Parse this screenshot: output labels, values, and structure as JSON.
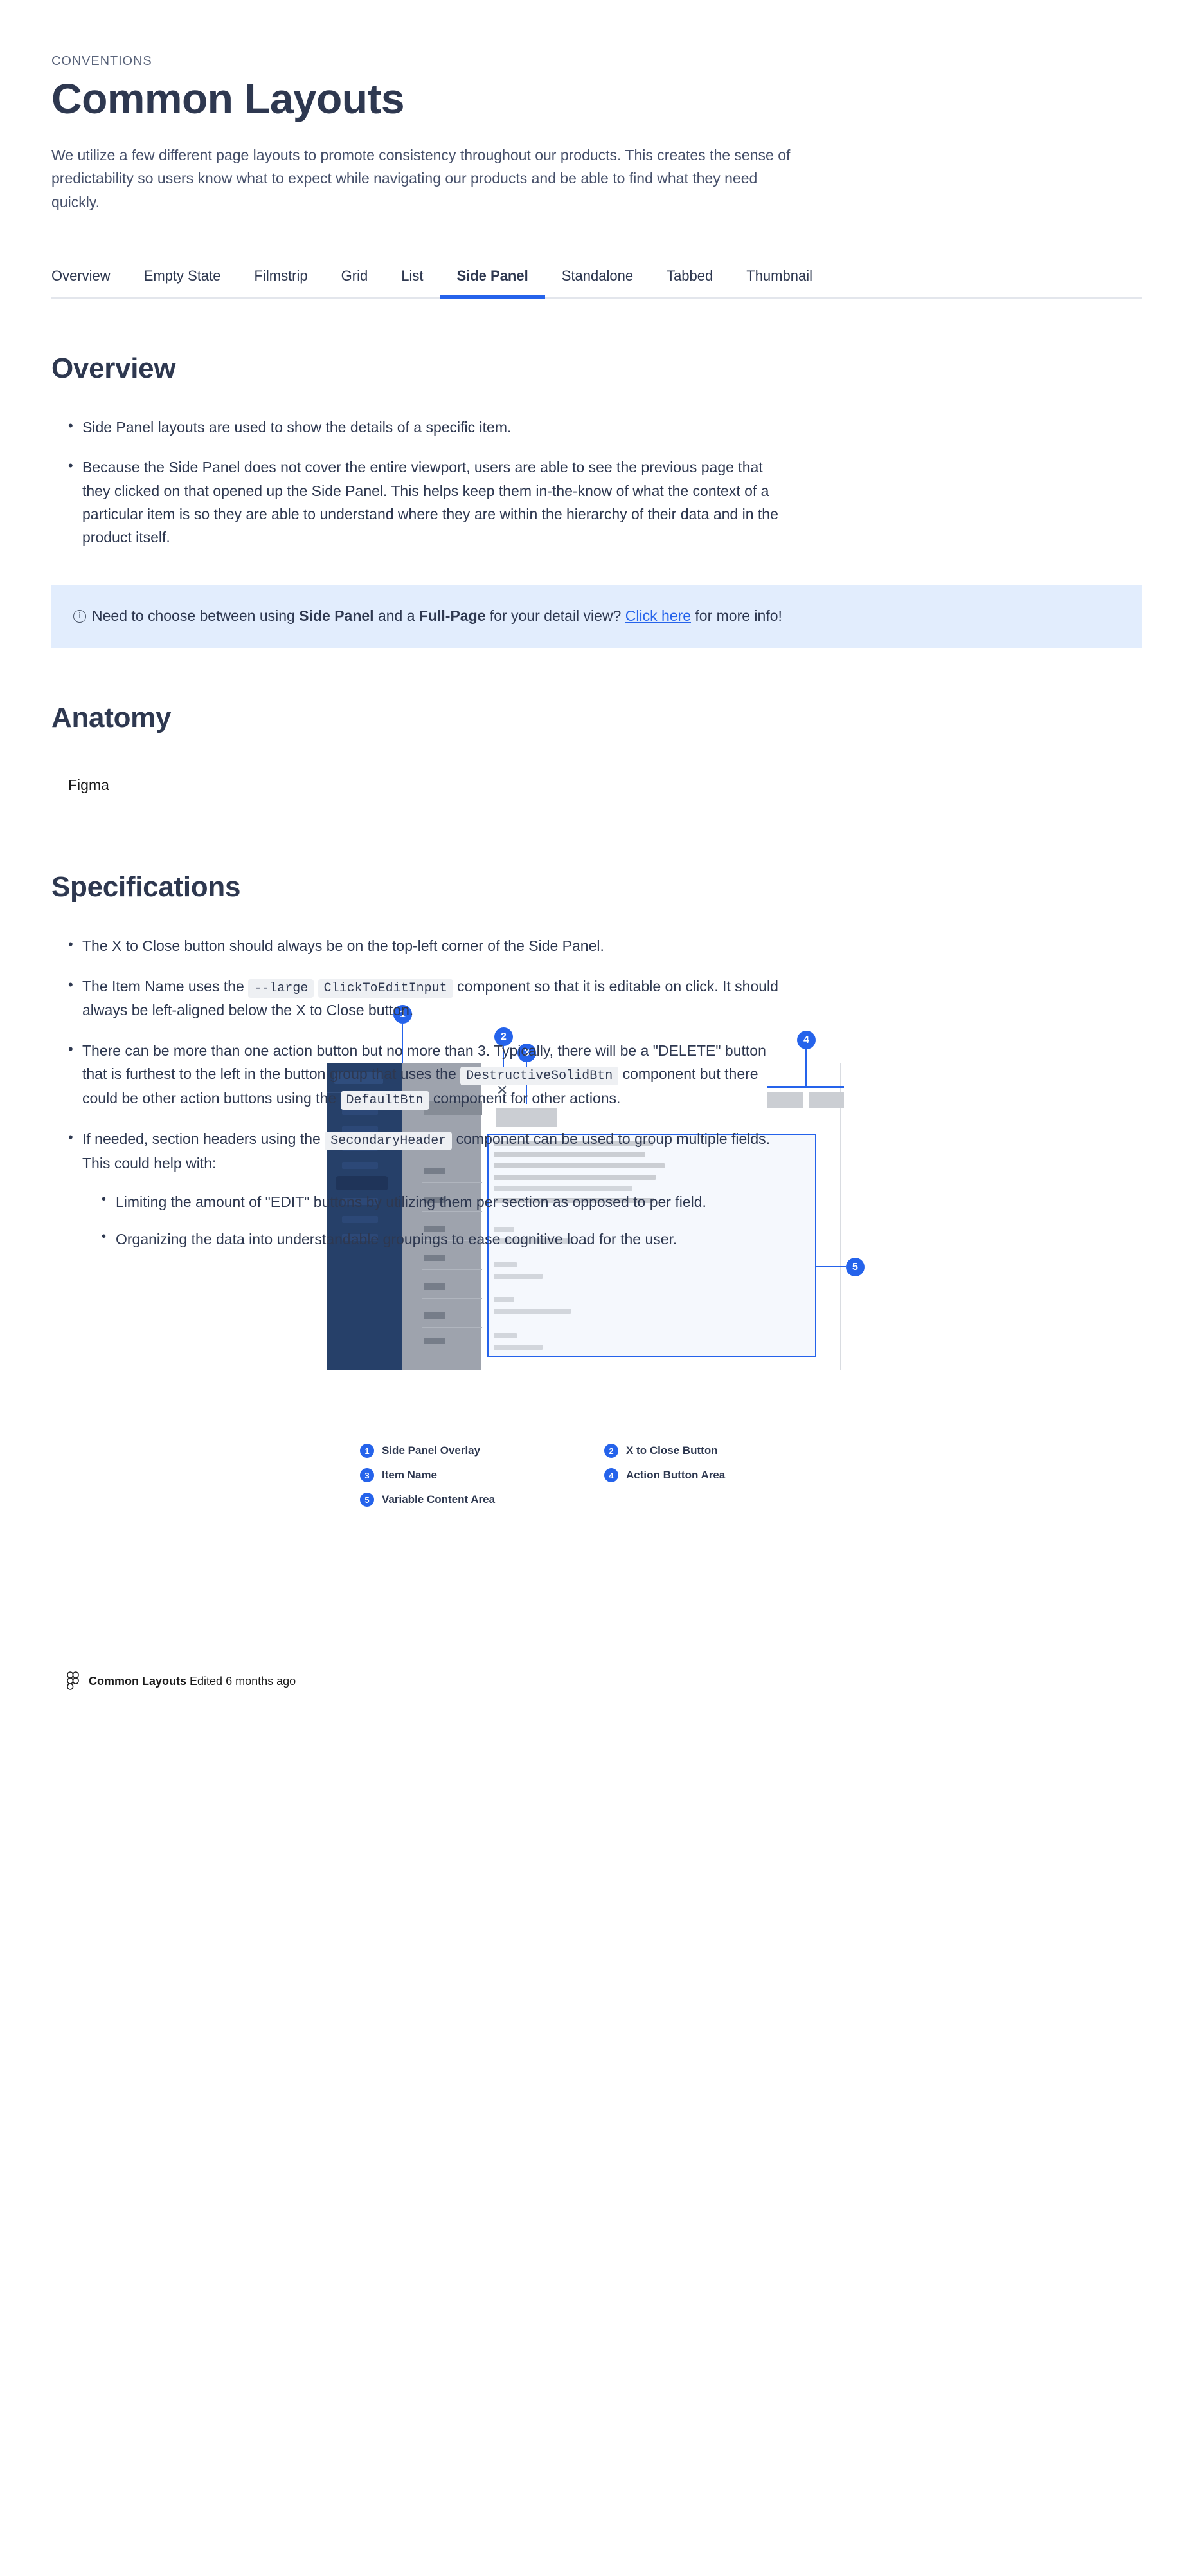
{
  "header": {
    "eyebrow": "CONVENTIONS",
    "title": "Common Layouts",
    "intro": "We utilize a few different page layouts to promote consistency throughout our products. This creates the sense of predictability so users know what to expect while navigating our products and be able to find what they need quickly."
  },
  "tabs": [
    {
      "label": "Overview",
      "active": false
    },
    {
      "label": "Empty State",
      "active": false
    },
    {
      "label": "Filmstrip",
      "active": false
    },
    {
      "label": "Grid",
      "active": false
    },
    {
      "label": "List",
      "active": false
    },
    {
      "label": "Side Panel",
      "active": true
    },
    {
      "label": "Standalone",
      "active": false
    },
    {
      "label": "Tabbed",
      "active": false
    },
    {
      "label": "Thumbnail",
      "active": false
    }
  ],
  "overview": {
    "title": "Overview",
    "bullets": [
      "Side Panel layouts are used to show the details of a specific item.",
      "Because the Side Panel does not cover the entire viewport, users are able to see the previous page that they clicked on that opened up the Side Panel. This helps keep them in-the-know of what the context of a particular item is so they are able to understand where they are within the hierarchy of their data and in the product itself."
    ]
  },
  "callout": {
    "icon": "info-circle-icon",
    "text_1": "Need to choose between using ",
    "bold_1": "Side Panel",
    "text_2": " and a ",
    "bold_2": "Full-Page",
    "text_3": " for your detail view? ",
    "link": "Click here",
    "text_4": " for more info!"
  },
  "anatomy": {
    "title": "Anatomy",
    "source_label": "Figma",
    "legend": [
      {
        "num": "1",
        "label": "Side Panel Overlay"
      },
      {
        "num": "2",
        "label": "X to Close Button"
      },
      {
        "num": "3",
        "label": "Item Name"
      },
      {
        "num": "4",
        "label": "Action Button Area"
      },
      {
        "num": "5",
        "label": "Variable Content Area"
      }
    ],
    "pins": [
      "1",
      "2",
      "3",
      "4",
      "5"
    ],
    "close_glyph": "✕",
    "footer": {
      "icon": "figma-icon",
      "file_name": "Common Layouts",
      "edited": "Edited 6 months ago"
    }
  },
  "specifications": {
    "title": "Specifications",
    "items": [
      {
        "parts": [
          {
            "t": "text",
            "v": "The X to Close button should always be on the top-left corner of the Side Panel."
          }
        ]
      },
      {
        "parts": [
          {
            "t": "text",
            "v": "The Item Name uses the "
          },
          {
            "t": "code",
            "v": "--large"
          },
          {
            "t": "text",
            "v": " "
          },
          {
            "t": "code",
            "v": "ClickToEditInput"
          },
          {
            "t": "text",
            "v": " component so that it is editable on click. It should always be left-aligned below the X to Close button."
          }
        ]
      },
      {
        "parts": [
          {
            "t": "text",
            "v": "There can be more than one action button but no more than 3. Typically, there will be a \"DELETE\" button that is furthest to the left in the button group that uses the "
          },
          {
            "t": "code",
            "v": "DestructiveSolidBtn"
          },
          {
            "t": "text",
            "v": " component but there could be other action buttons using the "
          },
          {
            "t": "code",
            "v": "DefaultBtn"
          },
          {
            "t": "text",
            "v": " component for other actions."
          }
        ]
      },
      {
        "parts": [
          {
            "t": "text",
            "v": "If needed, section headers using the "
          },
          {
            "t": "code",
            "v": "SecondaryHeader"
          },
          {
            "t": "text",
            "v": " component can be used to group multiple fields. This could help with:"
          }
        ],
        "sub": [
          "Limiting the amount of \"EDIT\" buttons by utilizing them per section as opposed to per field.",
          "Organizing the data into understandable groupings to ease cognitive load for the user."
        ]
      }
    ]
  },
  "colors": {
    "accent": "#2563eb",
    "text": "#2e3850",
    "callout_bg": "#e2edfd",
    "nav_dark": "#264069",
    "nav_grey": "#9ea3ad",
    "content_bg": "#f5f8fd"
  }
}
